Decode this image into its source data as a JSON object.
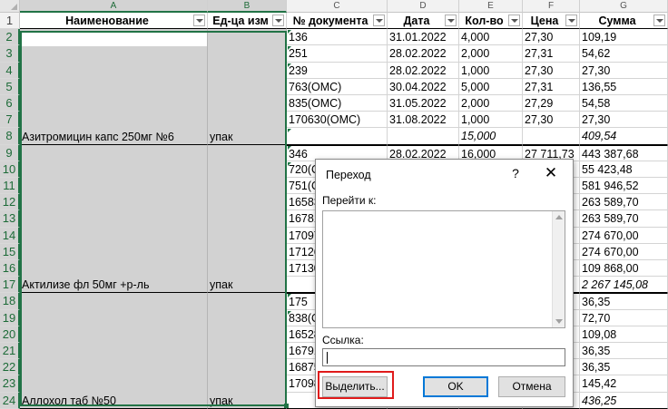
{
  "columns": [
    "A",
    "B",
    "C",
    "D",
    "E",
    "F",
    "G"
  ],
  "rows": [
    "1",
    "2",
    "3",
    "4",
    "5",
    "6",
    "7",
    "8",
    "9",
    "10",
    "11",
    "12",
    "13",
    "14",
    "15",
    "16",
    "17",
    "18",
    "19",
    "20",
    "21",
    "22",
    "23",
    "24"
  ],
  "headers": {
    "name": "Наименование",
    "unit": "Ед-ца изм",
    "doc": "№ документа",
    "date": "Дата",
    "qty": "Кол-во",
    "price": "Цена",
    "sum": "Сумма"
  },
  "groups": [
    {
      "name": "Азитромицин капс 250мг №6",
      "unit": "упак",
      "rows": [
        {
          "doc": "136",
          "date": "31.01.2022",
          "qty": "4,000",
          "price": "27,30",
          "sum": "109,19"
        },
        {
          "doc": "251",
          "date": "28.02.2022",
          "qty": "2,000",
          "price": "27,31",
          "sum": "54,62"
        },
        {
          "doc": "239",
          "date": "28.02.2022",
          "qty": "1,000",
          "price": "27,30",
          "sum": "27,30"
        },
        {
          "doc": "763(ОМС)",
          "date": "30.04.2022",
          "qty": "5,000",
          "price": "27,31",
          "sum": "136,55"
        },
        {
          "doc": "835(ОМС)",
          "date": "31.05.2022",
          "qty": "2,000",
          "price": "27,29",
          "sum": "54,58"
        },
        {
          "doc": "170630(ОМС)",
          "date": "31.08.2022",
          "qty": "1,000",
          "price": "27,30",
          "sum": "27,30"
        },
        {
          "doc": "",
          "date": "",
          "qty": "15,000",
          "price": "",
          "sum": "409,54"
        }
      ]
    },
    {
      "name": "Актилизе фл 50мг +р-ль",
      "unit": "упак",
      "rows": [
        {
          "doc": "346",
          "date": "28.02.2022",
          "qty": "16,000",
          "price": "27 711,73",
          "sum": "443 387,68"
        },
        {
          "doc": "720(О",
          "date": "",
          "qty": "",
          "price": "",
          "sum": "55 423,48"
        },
        {
          "doc": "751(О",
          "date": "",
          "qty": "",
          "price": "",
          "sum": "581 946,52"
        },
        {
          "doc": "16583",
          "date": "",
          "qty": "",
          "price": "",
          "sum": "263 589,70"
        },
        {
          "doc": "16781",
          "date": "",
          "qty": "",
          "price": "",
          "sum": "263 589,70"
        },
        {
          "doc": "17097",
          "date": "",
          "qty": "",
          "price": "",
          "sum": "274 670,00"
        },
        {
          "doc": "17126",
          "date": "",
          "qty": "",
          "price": "",
          "sum": "274 670,00"
        },
        {
          "doc": "17130",
          "date": "",
          "qty": "",
          "price": "",
          "sum": "109 868,00"
        },
        {
          "doc": "",
          "date": "",
          "qty": "",
          "price": "",
          "sum": "2 267 145,08"
        }
      ]
    },
    {
      "name": "Аллохол таб №50",
      "unit": "упак",
      "rows": [
        {
          "doc": "175",
          "date": "",
          "qty": "",
          "price": "",
          "sum": "36,35"
        },
        {
          "doc": "838(О",
          "date": "",
          "qty": "",
          "price": "",
          "sum": "72,70"
        },
        {
          "doc": "16528",
          "date": "",
          "qty": "",
          "price": "",
          "sum": "109,08"
        },
        {
          "doc": "16791",
          "date": "",
          "qty": "",
          "price": "",
          "sum": "36,35"
        },
        {
          "doc": "16875",
          "date": "",
          "qty": "",
          "price": "",
          "sum": "36,35"
        },
        {
          "doc": "17098",
          "date": "",
          "qty": "",
          "price": "",
          "sum": "145,42"
        },
        {
          "doc": "",
          "date": "",
          "qty": "",
          "price": "",
          "sum": "436,25"
        }
      ]
    }
  ],
  "dialog": {
    "title": "Переход",
    "help": "?",
    "close": "✕",
    "goto_label": "Перейти к:",
    "ref_label": "Ссылка:",
    "ref_value": "",
    "special_button": "Выделить...",
    "ok_button": "OK",
    "cancel_button": "Отмена"
  },
  "colors": {
    "selection": "#217346",
    "merged_fill": "#d2d2d2",
    "highlight": "#e01b1b"
  }
}
